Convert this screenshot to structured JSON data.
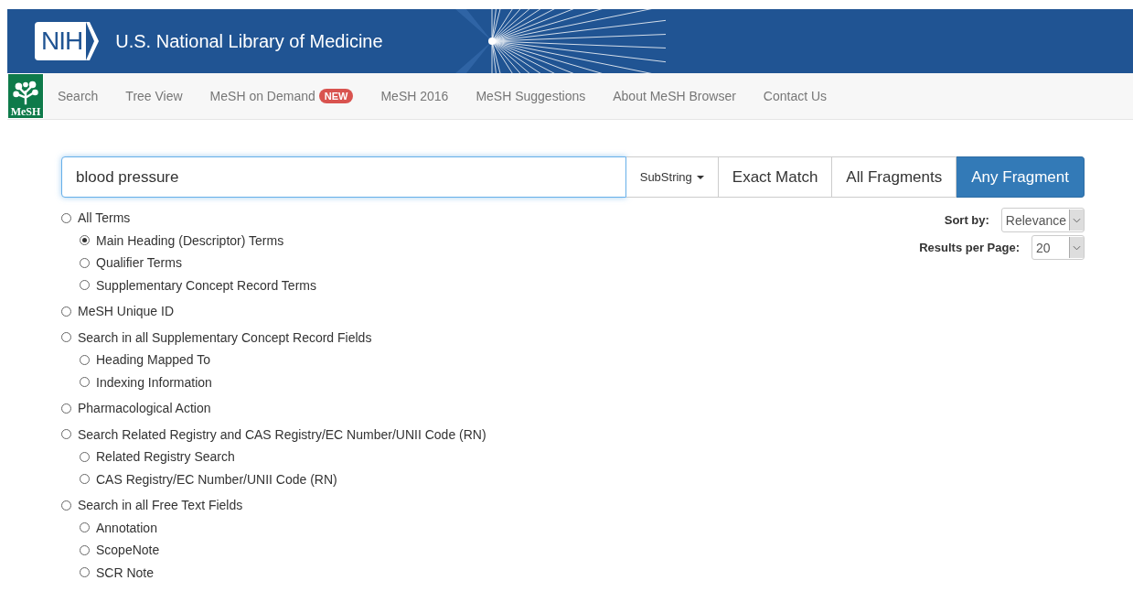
{
  "header": {
    "logo_text": "NIH",
    "title": "U.S. National Library of Medicine"
  },
  "nav": {
    "logo_text": "MeSH",
    "items": [
      {
        "label": "Search"
      },
      {
        "label": "Tree View"
      },
      {
        "label": "MeSH on Demand",
        "badge": "NEW"
      },
      {
        "label": "MeSH 2016"
      },
      {
        "label": "MeSH Suggestions"
      },
      {
        "label": "About MeSH Browser"
      },
      {
        "label": "Contact Us"
      }
    ]
  },
  "search": {
    "value": "blood pressure",
    "dropdown": "SubString",
    "modes": [
      {
        "label": "Exact Match",
        "selected": false
      },
      {
        "label": "All Fragments",
        "selected": false
      },
      {
        "label": "Any Fragment",
        "selected": true
      }
    ]
  },
  "sort": {
    "label": "Sort by:",
    "value": "Relevance"
  },
  "per_page": {
    "label": "Results per Page:",
    "value": "20"
  },
  "options": [
    {
      "label": "All Terms",
      "selected": false,
      "children": [
        {
          "label": "Main Heading (Descriptor) Terms",
          "selected": true
        },
        {
          "label": "Qualifier Terms",
          "selected": false
        },
        {
          "label": "Supplementary Concept Record Terms",
          "selected": false
        }
      ]
    },
    {
      "label": "MeSH Unique ID",
      "selected": false
    },
    {
      "label": "Search in all Supplementary Concept Record Fields",
      "selected": false,
      "children": [
        {
          "label": "Heading Mapped To",
          "selected": false
        },
        {
          "label": "Indexing Information",
          "selected": false
        }
      ]
    },
    {
      "label": "Pharmacological Action",
      "selected": false
    },
    {
      "label": "Search Related Registry and CAS Registry/EC Number/UNII Code (RN)",
      "selected": false,
      "children": [
        {
          "label": "Related Registry Search",
          "selected": false
        },
        {
          "label": "CAS Registry/EC Number/UNII Code (RN)",
          "selected": false
        }
      ]
    },
    {
      "label": "Search in all Free Text Fields",
      "selected": false,
      "children": [
        {
          "label": "Annotation",
          "selected": false
        },
        {
          "label": "ScopeNote",
          "selected": false
        },
        {
          "label": "SCR Note",
          "selected": false
        }
      ]
    }
  ]
}
